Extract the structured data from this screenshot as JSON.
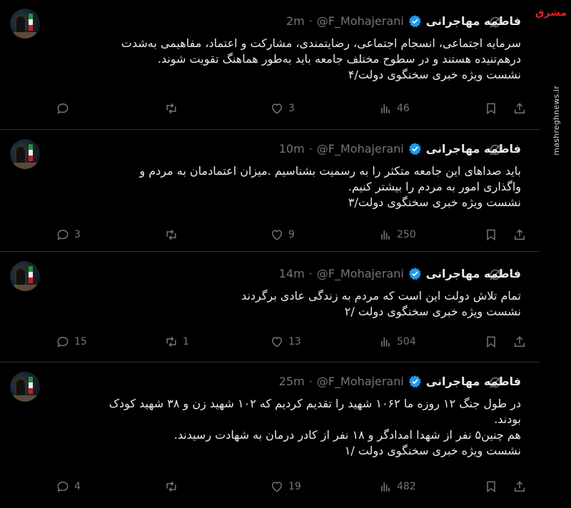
{
  "tweets": [
    {
      "name": "فاطمه مهاجرانی",
      "handle": "@F_Mohajerani",
      "time": "2m",
      "lines": [
        "سرمایه اجتماعی، انسجام اجتماعی، رضایتمندی، مشارکت و اعتماد، مفاهیمی به‌شدت",
        "درهم‌تنیده هستند و در سطوح مختلف جامعه باید به‌طور هماهنگ تقویت شوند.",
        "نشست ویژه خبری سخنگوی دولت/۴"
      ],
      "replies": "",
      "retweets": "",
      "likes": "3",
      "views": "46"
    },
    {
      "name": "فاطمه مهاجرانی",
      "handle": "@F_Mohajerani",
      "time": "10m",
      "lines": [
        "باید صداهای این جامعه متکثر را به رسمیت بشناسیم .میزان اعتمادمان به مردم و",
        "واگذاری امور به مردم را بیشتر کنیم.",
        "نشست ویژه خبری سخنگوی دولت/۳"
      ],
      "replies": "3",
      "retweets": "",
      "likes": "9",
      "views": "250"
    },
    {
      "name": "فاطمه مهاجرانی",
      "handle": "@F_Mohajerani",
      "time": "14m",
      "lines": [
        "تمام تلاش دولت این است که مردم به زندگی عادی برگردند",
        "نشست ویژه خبری سخنگوی دولت /۲"
      ],
      "replies": "15",
      "retweets": "1",
      "likes": "13",
      "views": "504"
    },
    {
      "name": "فاطمه مهاجرانی",
      "handle": "@F_Mohajerani",
      "time": "25m",
      "lines": [
        "در طول جنگ ۱۲ روزه ما ۱۰۶۲ شهید را تقدیم کردیم که ۱۰۲ شهید زن و ۳۸ شهید کودک",
        "بودند.",
        "هم چنین۵ نفر از شهدا امدادگر و ۱۸ نفر از کادر درمان به شهادت رسیدند.",
        "نشست ویژه خبری سخنگوی دولت /۱"
      ],
      "replies": "4",
      "retweets": "",
      "likes": "19",
      "views": "482"
    }
  ],
  "watermark": {
    "logo_a": "مشرق",
    "url": "mashreghnews.ir"
  },
  "colors": {
    "background": "#000000",
    "text": "#e7e9ea",
    "muted": "#71767b",
    "verified": "#1d9bf0",
    "divider": "#2f3336"
  }
}
